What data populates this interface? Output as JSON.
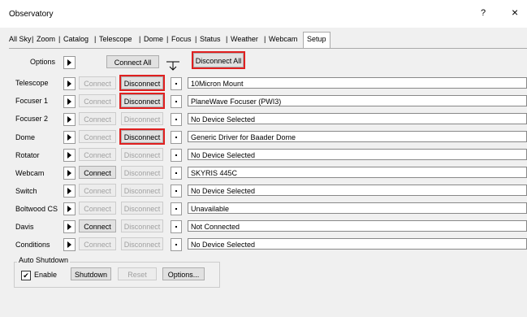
{
  "window": {
    "title": "Observatory",
    "help": "?",
    "close": "×"
  },
  "tabs": [
    "All Sky",
    "Zoom",
    "Catalog",
    "Telescope",
    "Dome",
    "Focus",
    "Status",
    "Weather",
    "Webcam",
    "Setup"
  ],
  "options_row": {
    "label": "Options",
    "connect_all": "Connect All",
    "disconnect_all": "Disconnect All"
  },
  "rows": [
    {
      "label": "Telescope",
      "connect": "Connect",
      "disconnect": "Disconnect",
      "device": "10Micron Mount"
    },
    {
      "label": "Focuser 1",
      "connect": "Connect",
      "disconnect": "Disconnect",
      "device": "PlaneWave Focuser (PWI3)"
    },
    {
      "label": "Focuser 2",
      "connect": "Connect",
      "disconnect": "Disconnect",
      "device": "No Device Selected"
    },
    {
      "label": "Dome",
      "connect": "Connect",
      "disconnect": "Disconnect",
      "device": "Generic Driver for Baader Dome"
    },
    {
      "label": "Rotator",
      "connect": "Connect",
      "disconnect": "Disconnect",
      "device": "No Device Selected"
    },
    {
      "label": "Webcam",
      "connect": "Connect",
      "disconnect": "Disconnect",
      "device": "SKYRIS 445C"
    },
    {
      "label": "Switch",
      "connect": "Connect",
      "disconnect": "Disconnect",
      "device": "No Device Selected"
    },
    {
      "label": "Boltwood CS",
      "connect": "Connect",
      "disconnect": "Disconnect",
      "device": "Unavailable"
    },
    {
      "label": "Davis",
      "connect": "Connect",
      "disconnect": "Disconnect",
      "device": "Not Connected"
    },
    {
      "label": "Conditions",
      "connect": "Connect",
      "disconnect": "Disconnect",
      "device": "No Device Selected"
    }
  ],
  "auto_shutdown": {
    "legend": "Auto Shutdown",
    "enable_label": "Enable",
    "enable_checked": true,
    "check_mark": "✔",
    "shutdown": "Shutdown",
    "reset": "Reset",
    "options": "Options..."
  }
}
